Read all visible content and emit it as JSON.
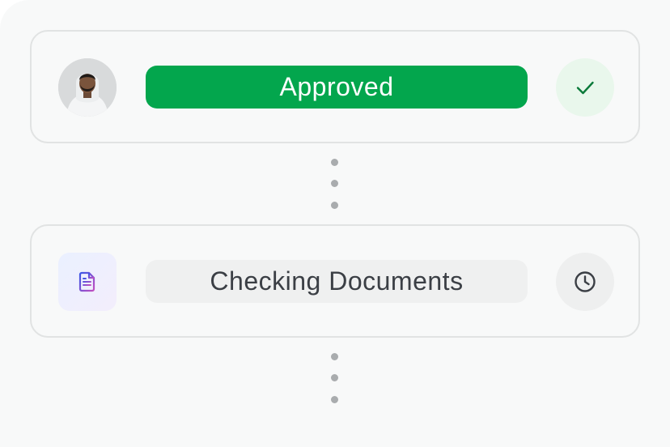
{
  "steps": [
    {
      "label": "Approved",
      "left_icon": "user-avatar",
      "status_icon": "check-icon",
      "colors": {
        "pill": "#03a64d",
        "text": "#ffffff",
        "status_bg": "#e9f7ec",
        "status_icon": "#0b7a3a"
      }
    },
    {
      "label": "Checking Documents",
      "left_icon": "document-icon",
      "status_icon": "clock-icon",
      "colors": {
        "pill": "#eff0f0",
        "text": "#3b3f45",
        "status_bg": "#eeefef",
        "status_icon": "#3b3f45"
      }
    }
  ]
}
